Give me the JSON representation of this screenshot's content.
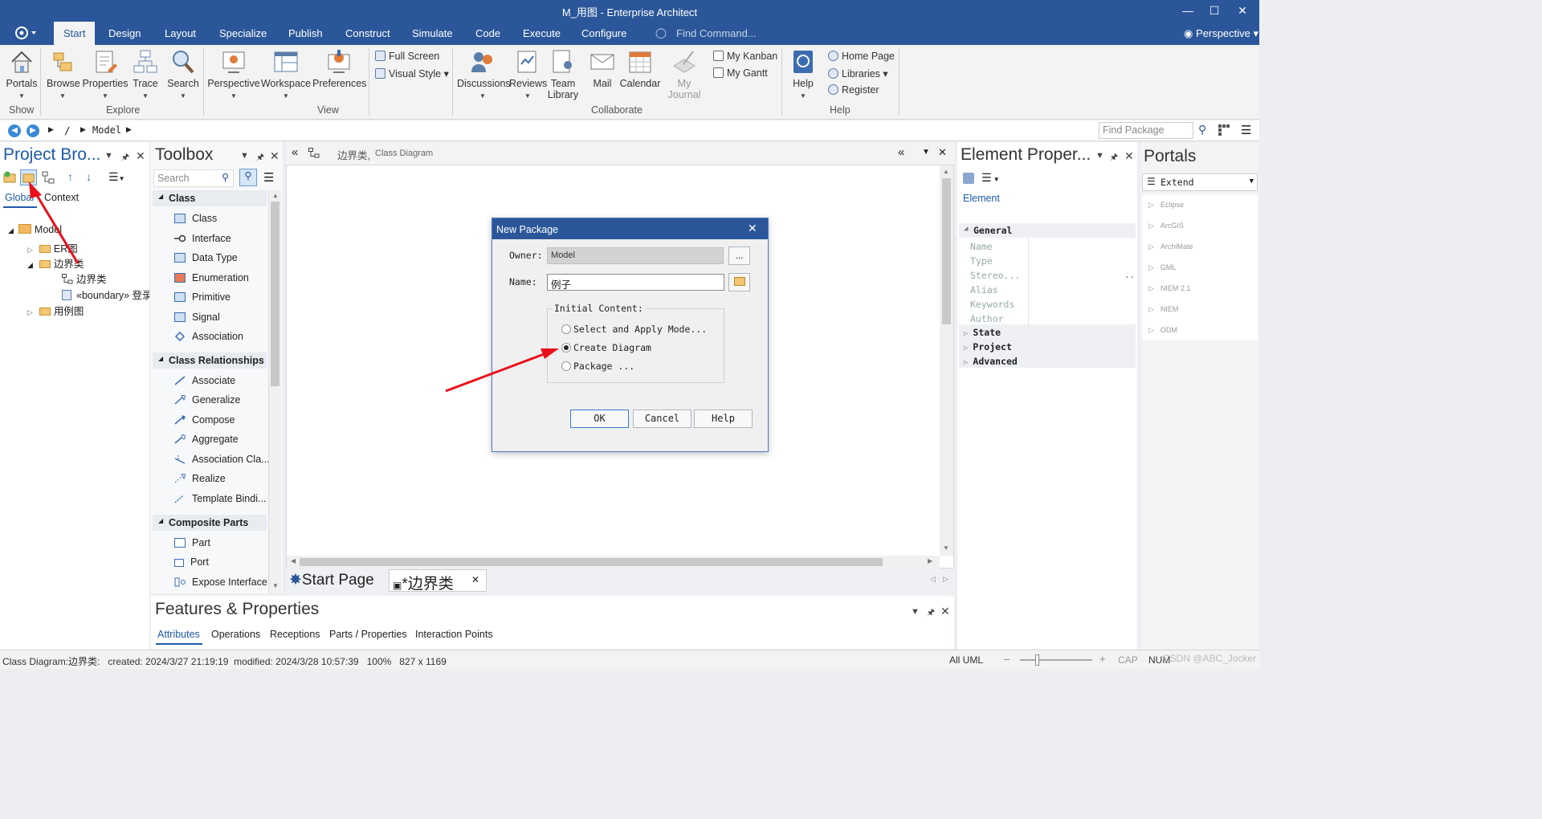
{
  "window": {
    "title": "M_用图 - Enterprise Architect"
  },
  "menu": {
    "items": [
      "Start",
      "Design",
      "Layout",
      "Specialize",
      "Publish",
      "Construct",
      "Simulate",
      "Code",
      "Execute",
      "Configure"
    ],
    "find_command": "Find Command...",
    "perspective": "Perspective"
  },
  "ribbon": {
    "show": {
      "portals": "Portals",
      "group": "Show"
    },
    "explore": {
      "browse": "Browse",
      "properties": "Properties",
      "trace": "Trace",
      "search": "Search",
      "group": "Explore"
    },
    "view": {
      "perspective": "Perspective",
      "workspace": "Workspace",
      "preferences": "Preferences",
      "full_screen": "Full Screen",
      "visual_style": "Visual Style",
      "group": "View"
    },
    "collaborate": {
      "discussions": "Discussions",
      "reviews": "Reviews",
      "team": "Team",
      "library": "Library",
      "mail": "Mail",
      "calendar": "Calendar",
      "my": "My",
      "journal": "Journal",
      "my_kanban": "My Kanban",
      "my_gantt": "My Gantt",
      "group": "Collaborate"
    },
    "help": {
      "help": "Help",
      "home_page": "Home Page",
      "libraries": "Libraries",
      "register": "Register",
      "group": "Help"
    }
  },
  "address": {
    "path_root": "/",
    "path_model": "Model",
    "find_package": "Find Package"
  },
  "project_browser": {
    "title": "Project Bro...",
    "tabs": [
      "Global",
      "Context"
    ],
    "tree": {
      "model": "Model",
      "er": "ER图",
      "boundary": "边界类",
      "boundary_diagram": "边界类",
      "boundary_element": "«boundary» 登录",
      "usecase": "用例图"
    }
  },
  "toolbox": {
    "title": "Toolbox",
    "search_placeholder": "Search",
    "class_head": "Class",
    "class_items": [
      "Class",
      "Interface",
      "Data Type",
      "Enumeration",
      "Primitive",
      "Signal",
      "Association"
    ],
    "rel_head": "Class Relationships",
    "rel_items": [
      "Associate",
      "Generalize",
      "Compose",
      "Aggregate",
      "Association Cla...",
      "Realize",
      "Template Bindi..."
    ],
    "comp_head": "Composite Parts",
    "comp_items": [
      "Part",
      "Port",
      "Expose Interface"
    ]
  },
  "diagram": {
    "title": "边界类,",
    "subtitle": "Class Diagram",
    "tabs": [
      "Start Page",
      "*边界类"
    ]
  },
  "dialog": {
    "title": "New Package",
    "owner_label": "Owner:",
    "owner_value": "Model",
    "owner_button": "...",
    "name_label": "Name:",
    "name_value": "例子",
    "initial_content": "Initial Content:",
    "option_1": "Select and Apply Mode...",
    "option_2": "Create Diagram",
    "option_3": "Package ...",
    "selected_option": "Create Diagram",
    "ok": "OK",
    "cancel": "Cancel",
    "help": "Help"
  },
  "features": {
    "title": "Features & Properties",
    "tabs": [
      "Attributes",
      "Operations",
      "Receptions",
      "Parts / Properties",
      "Interaction Points"
    ]
  },
  "element_properties": {
    "title": "Element Proper...",
    "tab": "Element",
    "general": "General",
    "fields": [
      "Name",
      "Type",
      "Stereo...",
      "Alias",
      "Keywords",
      "Author"
    ],
    "stereo_value": "..",
    "sections": [
      "State",
      "Project",
      "Advanced"
    ]
  },
  "portals": {
    "title": "Portals",
    "dropdown": "Extend",
    "items": [
      "Eclipse",
      "ArcGIS",
      "ArchiMate",
      "GML",
      "NIEM 2.1",
      "NIEM",
      "ODM"
    ]
  },
  "status": {
    "info": "Class Diagram:边界类:   created: 2024/3/27 21:19:19  modified: 2024/3/28 10:57:39   100%   827 x 1169",
    "all_uml": "All UML",
    "cap": "CAP",
    "num": "NUM",
    "watermark": "CSDN @ABC_Jocker"
  },
  "colors": {
    "titlebar": "#2b579a",
    "accent": "#1e5aa8",
    "arrow": "#e8101a"
  }
}
